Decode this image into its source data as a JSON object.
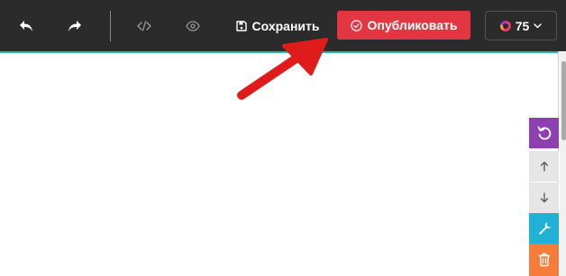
{
  "toolbar": {
    "undo_icon": "undo-icon",
    "redo_icon": "redo-icon",
    "code_icon": "code-icon",
    "preview_icon": "eye-icon",
    "save": {
      "icon": "floppy-disk-icon",
      "label": "Сохранить"
    },
    "publish": {
      "icon": "check-circle-icon",
      "label": "Опубликовать",
      "color": "#e23742"
    },
    "credits": {
      "icon": "donut-icon",
      "value": "75",
      "chevron": "chevron-down-icon"
    }
  },
  "side_tools": [
    {
      "name": "reset",
      "icon": "reset-icon",
      "color": "#8e3fb0"
    },
    {
      "name": "move-up",
      "icon": "arrow-up-icon",
      "color": "#e6e6e6"
    },
    {
      "name": "move-down",
      "icon": "arrow-down-icon",
      "color": "#e6e6e6"
    },
    {
      "name": "settings",
      "icon": "wrench-icon",
      "color": "#1fb2d6"
    },
    {
      "name": "delete",
      "icon": "trash-icon",
      "color": "#f57c3a"
    }
  ],
  "colors": {
    "toolbar_bg": "#2b2b2b",
    "canvas_border": "#25b7a3",
    "annotation_arrow": "#e01b1b"
  }
}
